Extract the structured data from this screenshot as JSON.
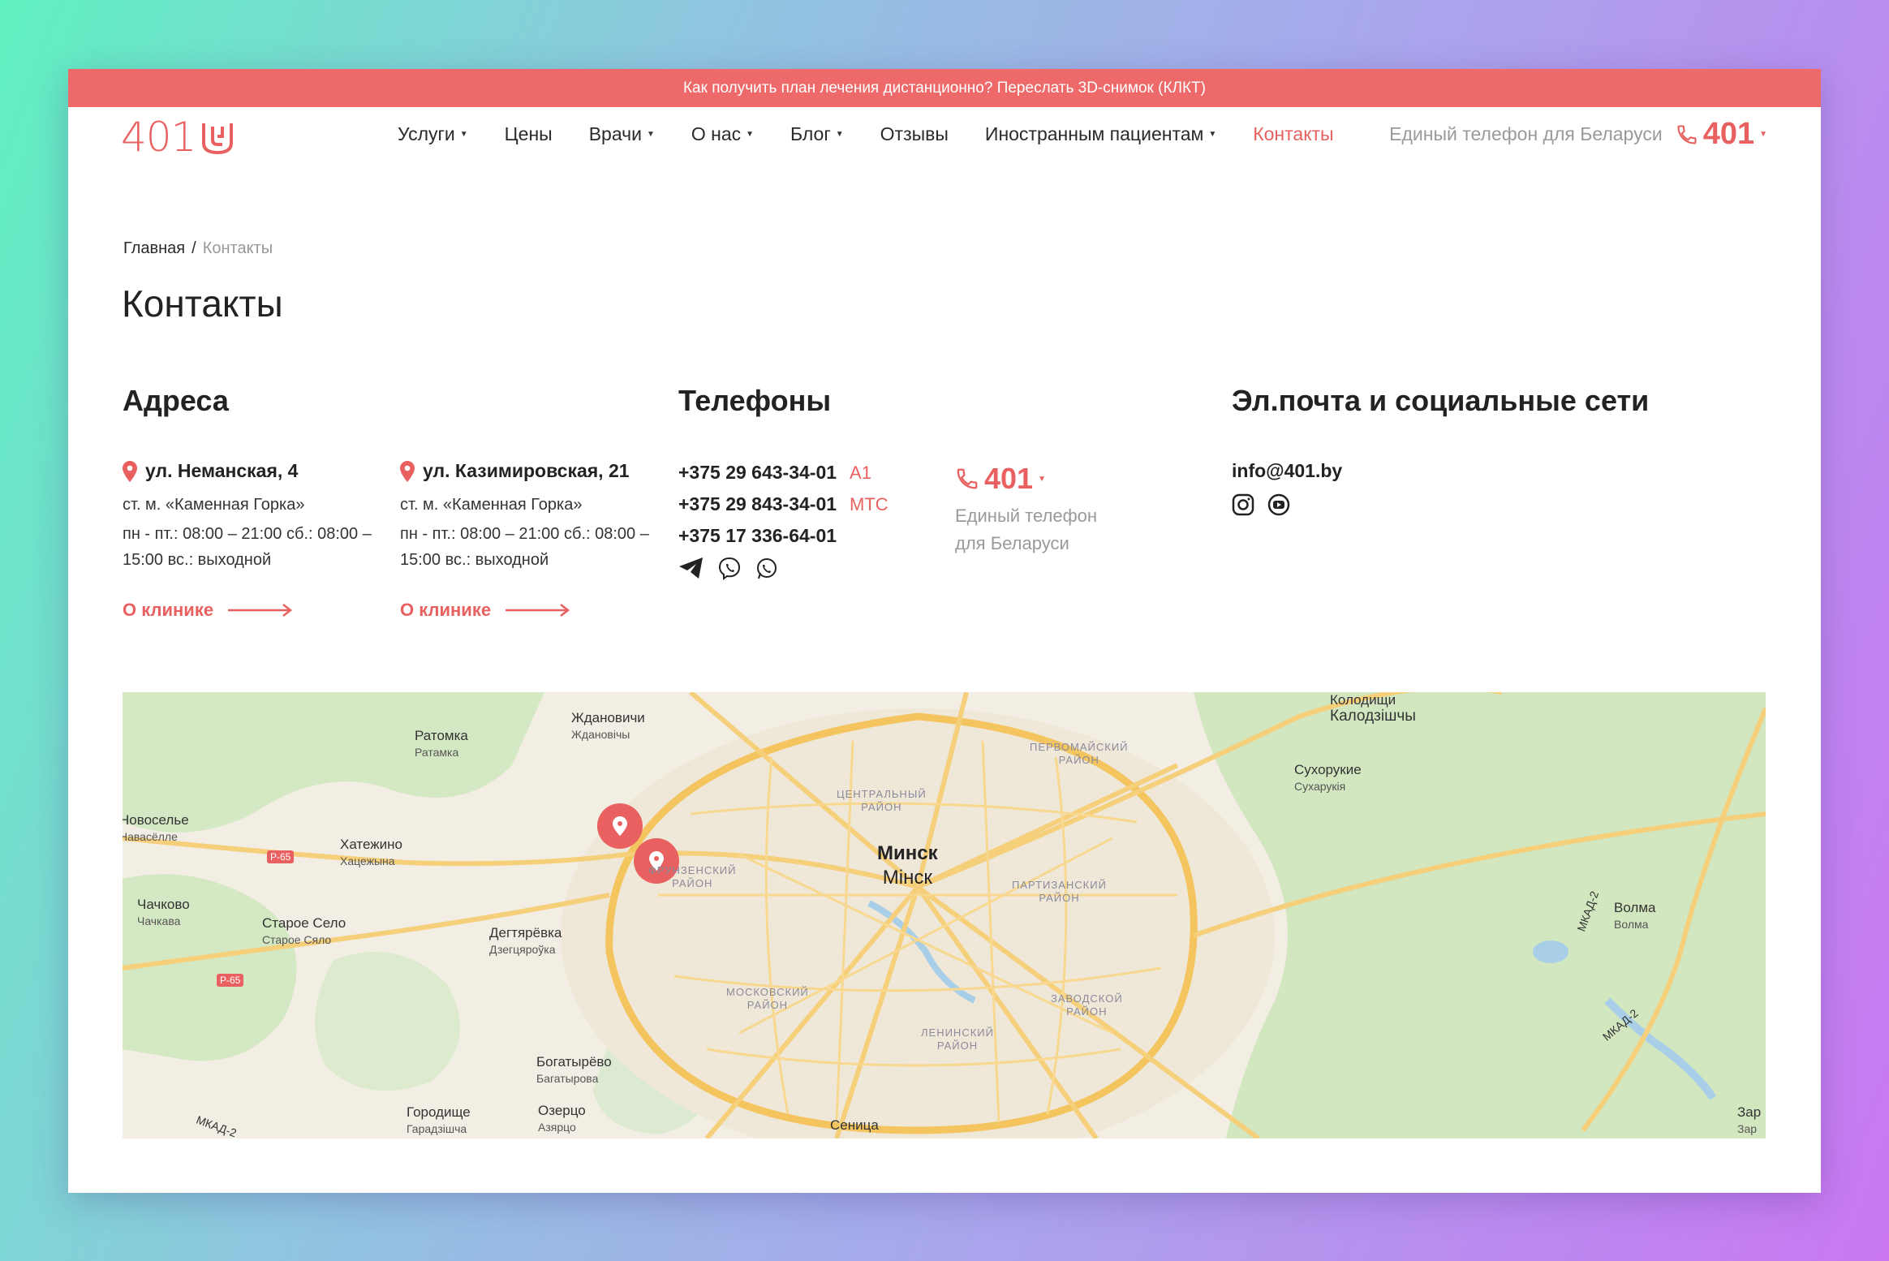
{
  "topbar": {
    "text": "Как получить план лечения дистанционно? Переслать 3D-снимок (КЛКТ)"
  },
  "logo": {
    "text": "401"
  },
  "nav": {
    "items": [
      {
        "label": "Услуги",
        "caret": "▼"
      },
      {
        "label": "Цены"
      },
      {
        "label": "Врачи",
        "caret": "▼"
      },
      {
        "label": "О нас",
        "caret": "▼"
      },
      {
        "label": "Блог",
        "caret": "▼"
      },
      {
        "label": "Отзывы"
      },
      {
        "label": "Иностранным пациентам",
        "caret": "▼"
      },
      {
        "label": "Контакты",
        "active": true
      }
    ]
  },
  "header_phone": {
    "label": "Единый телефон для Беларуси",
    "number": "401",
    "caret": "▼"
  },
  "breadcrumb": {
    "home": "Главная",
    "separator": "/",
    "current": "Контакты"
  },
  "page_title": "Контакты",
  "addresses": {
    "title": "Адреса",
    "items": [
      {
        "street": "ул. Неманская, 4",
        "metro": "ст. м. «Каменная Горка»",
        "hours": "пн - пт.: 08:00 – 21:00 сб.: 08:00 – 15:00 вс.: выходной",
        "link": "О клинике"
      },
      {
        "street": "ул. Казимировская, 21",
        "metro": "ст. м. «Каменная Горка»",
        "hours": "пн - пт.: 08:00 – 21:00 сб.: 08:00 – 15:00 вс.: выходной",
        "link": "О клинике"
      }
    ]
  },
  "phones": {
    "title": "Телефоны",
    "items": [
      {
        "number": "+375 29 643-34-01",
        "operator": "A1"
      },
      {
        "number": "+375 29 843-34-01",
        "operator": "МТС"
      },
      {
        "number": "+375 17 336-64-01",
        "operator": ""
      }
    ],
    "single": {
      "number": "401",
      "caret": "▼",
      "desc": "Единый телефон для Беларуси"
    }
  },
  "contacts": {
    "title": "Эл.почта и социальные сети",
    "email": "info@401.by"
  },
  "colors": {
    "accent": "#e8605f",
    "topbar": "#ee6a6a",
    "text": "#222222",
    "muted": "#9a9a9a"
  },
  "icons": [
    "phone-icon",
    "location-pin-icon",
    "arrow-right-icon",
    "telegram-icon",
    "viber-icon",
    "whatsapp-icon",
    "instagram-icon",
    "youtube-icon",
    "map-marker-icon"
  ],
  "map": {
    "labels": [
      {
        "name": "Ратомка",
        "sub": "Ратамка"
      },
      {
        "name": "Ждановичи",
        "sub": "Ждановічы"
      },
      {
        "name": "Новоселье",
        "sub": "Навасёлле"
      },
      {
        "name": "Хатежино",
        "sub": "Хацежына"
      },
      {
        "name": "Чачково",
        "sub": "Чачкава"
      },
      {
        "name": "Старое Село",
        "sub": "Старое Сяло"
      },
      {
        "name": "Дегтярёвка",
        "sub": "Дзегцяроўка"
      },
      {
        "name": "Богатырёво",
        "sub": "Багатырова"
      },
      {
        "name": "Городище",
        "sub": "Гарадзішча"
      },
      {
        "name": "Озерцо",
        "sub": "Азярцо"
      },
      {
        "name": "Сеница",
        "sub": ""
      },
      {
        "name": "Колодищи",
        "sub": "Калодзішчы"
      },
      {
        "name": "Сухорукие",
        "sub": "Сухарукія"
      },
      {
        "name": "Волма",
        "sub": "Волма"
      },
      {
        "name": "Зар",
        "sub": "Зар"
      }
    ],
    "city": {
      "name": "Минск",
      "sub": "Мінск"
    },
    "districts": [
      {
        "line1": "ПЕРВОМАЙСКИЙ",
        "line2": "РАЙОН"
      },
      {
        "line1": "ЦЕНТРАЛЬНЫЙ",
        "line2": "РАЙОН"
      },
      {
        "line1": "ФРУНЗЕНСКИЙ",
        "line2": "РАЙОН"
      },
      {
        "line1": "ПАРТИЗАНСКИЙ",
        "line2": "РАЙОН"
      },
      {
        "line1": "МОСКОВСКИЙ",
        "line2": "РАЙОН"
      },
      {
        "line1": "ЗАВОДСКОЙ",
        "line2": "РАЙОН"
      },
      {
        "line1": "ЛЕНИНСКИЙ",
        "line2": "РАЙОН"
      }
    ],
    "roads": [
      "Р-65",
      "Р-65",
      "МКАД-2",
      "МКАД-2",
      "МКАД-2"
    ]
  }
}
